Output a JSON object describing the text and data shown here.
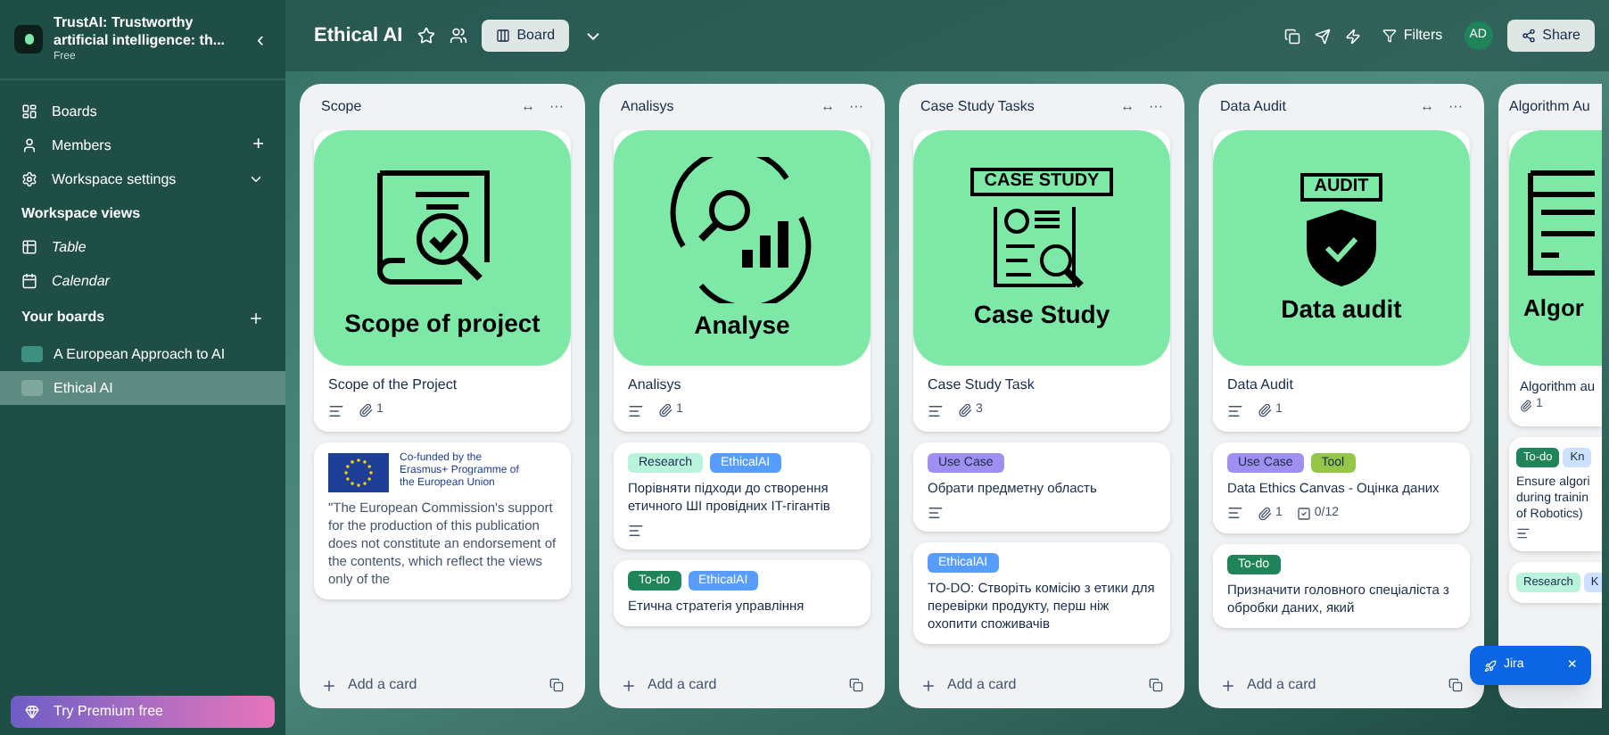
{
  "sidebar": {
    "workspace": {
      "name": "TrustAI: Trustworthy artificial intelligence: th...",
      "plan": "Free",
      "collapse": "‹"
    },
    "nav": [
      {
        "label": "Boards"
      },
      {
        "label": "Members",
        "add": "+"
      },
      {
        "label": "Workspace settings",
        "expanded": false
      }
    ],
    "views_title": "Workspace views",
    "views": [
      {
        "label": "Table"
      },
      {
        "label": "Calendar"
      }
    ],
    "boards_title": "Your boards",
    "boards": [
      {
        "label": "A European Approach to AI",
        "selected": false,
        "color": "#3d8f7f"
      },
      {
        "label": "Ethical AI",
        "selected": true,
        "color": "#7fa79c"
      }
    ],
    "premium": "Try Premium free"
  },
  "header": {
    "title": "Ethical AI",
    "view": "Board",
    "filters": "Filters",
    "avatar": "AD",
    "share": "Share"
  },
  "lists": [
    {
      "title": "Scope",
      "add_card": "Add a card",
      "cards": [
        {
          "kind": "cover",
          "cover": {
            "caption": "Scope of project"
          },
          "title": "Scope of the Project",
          "description": true,
          "attachments": "1"
        },
        {
          "kind": "eu",
          "logo_text": "Co-funded by the Erasmus+ Programme of the European Union",
          "text": "\"The European Commission's support for the production of this publication does not constitute an endorsement of the contents, which reflect the views only of the"
        }
      ]
    },
    {
      "title": "Analisys",
      "add_card": "Add a card",
      "cards": [
        {
          "kind": "cover",
          "cover": {
            "caption": "Analyse"
          },
          "title": "Analisys",
          "description": true,
          "attachments": "1"
        },
        {
          "kind": "labeled",
          "labels": [
            {
              "text": "Research",
              "color": "#baf3db"
            },
            {
              "text": "EthicalAI",
              "color": "#579dff"
            }
          ],
          "text": "Порівняти підходи до створення етичного ШІ провідних IT-гігантів",
          "description": true
        },
        {
          "kind": "labeled",
          "labels": [
            {
              "text": "To-do",
              "color": "#1f845a"
            },
            {
              "text": "EthicalAI",
              "color": "#579dff"
            }
          ],
          "text": "Етична стратегія управління",
          "description": false
        }
      ]
    },
    {
      "title": "Case Study Tasks",
      "add_card": "Add a card",
      "cards": [
        {
          "kind": "cover",
          "cover": {
            "sign": "CASE STUDY",
            "caption": "Case Study"
          },
          "title": "Case Study Task",
          "description": true,
          "attachments": "3"
        },
        {
          "kind": "labeled",
          "labels": [
            {
              "text": "Use Case",
              "color": "#9f8fef"
            }
          ],
          "text": "Обрати предметну область",
          "description": true
        },
        {
          "kind": "labeled",
          "labels": [
            {
              "text": "EthicalAI",
              "color": "#579dff"
            }
          ],
          "text": "TO-DO: Створіть комісію з етики для перевірки продукту, перш ніж охопити споживачів",
          "description": false
        }
      ]
    },
    {
      "title": "Data Audit",
      "add_card": "Add a card",
      "cards": [
        {
          "kind": "cover",
          "cover": {
            "sign": "AUDIT",
            "caption": "Data audit"
          },
          "title": "Data Audit",
          "description": true,
          "attachments": "1"
        },
        {
          "kind": "labeled",
          "labels": [
            {
              "text": "Use Case",
              "color": "#9f8fef"
            },
            {
              "text": "Tool",
              "color": "#94c748"
            }
          ],
          "text": "Data Ethics Canvas - Оцінка даних",
          "description": true,
          "attachments": "1",
          "checklist": "0/12"
        },
        {
          "kind": "labeled",
          "labels": [
            {
              "text": "To-do",
              "color": "#1f845a"
            }
          ],
          "text": "Призначити головного спеціаліста з обробки даних, який",
          "description": false
        }
      ]
    }
  ],
  "list_actions": {
    "collapse": "↔",
    "more": "···"
  },
  "partial_list": {
    "title": "Algorithm Au",
    "caption": "Algor",
    "card_title": "Algorithm au",
    "attachments": "1",
    "cards": [
      {
        "labels": [
          {
            "text": "To-do",
            "color": "#1f845a"
          },
          {
            "text": "Kn",
            "color": "#cce0ff"
          }
        ],
        "text": "Ensure algori\nduring trainin\nof Robotics)",
        "description": true
      },
      {
        "labels": [
          {
            "text": "Research",
            "color": "#baf3db"
          },
          {
            "text": "K",
            "color": "#cce0ff"
          }
        ],
        "description": false
      }
    ]
  },
  "jira": {
    "label": "Jira",
    "close": "×"
  }
}
